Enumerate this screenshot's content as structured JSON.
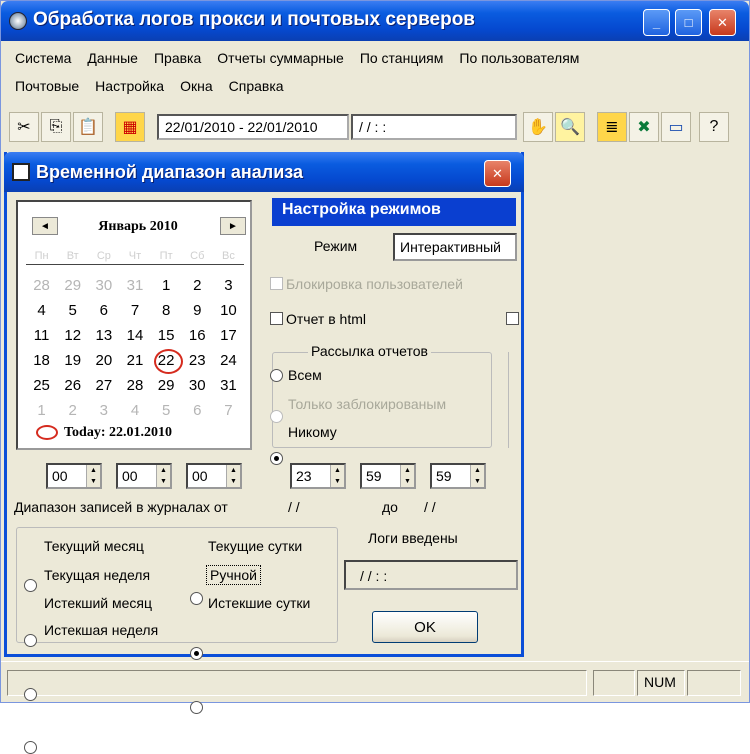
{
  "window": {
    "title": "Обработка логов прокси и почтовых серверов",
    "minimize": "_",
    "maximize": "□",
    "close": "✕"
  },
  "menu_row_1": [
    "Система",
    "Данные",
    "Правка",
    "Отчеты суммарные",
    "По станциям",
    "По пользователям"
  ],
  "menu_row_2": [
    "Почтовые",
    "Настройка",
    "Окна",
    "Справка"
  ],
  "toolbar": {
    "date_range": "22/01/2010 - 22/01/2010",
    "datetime_field": " / /     : :",
    "icons": [
      "scissors-icon",
      "copy-icon",
      "paste-icon",
      "grid-icon",
      "hand-icon",
      "preview-icon",
      "note-icon",
      "excel-icon",
      "monitor-icon",
      "help-icon"
    ]
  },
  "dialog": {
    "title": "Временной диапазон анализа",
    "close": "✕",
    "calendar": {
      "month": "Январь 2010",
      "prev": "◄",
      "next": "►",
      "weekdays": [
        "Пн",
        "Вт",
        "Ср",
        "Чт",
        "Пт",
        "Сб",
        "Вс"
      ],
      "today_label": "Today: 22.01.2010"
    },
    "settings_header": "Настройка режимов",
    "mode_label": "Режим",
    "mode_value": "Интерактивный",
    "block_users": "Блокировка пользователей",
    "report_html": "Отчет в html",
    "mailing_title": "Рассылка отчетов",
    "mailing_all": "Всем",
    "mailing_blocked": "Только заблокированым",
    "mailing_none": "Никому",
    "time_from": [
      "00",
      "00",
      "00"
    ],
    "time_to": [
      "23",
      "59",
      "59"
    ],
    "range_label": "Диапазон записей в журналах от",
    "range_from": "/ /",
    "range_to_label": "до",
    "range_to": "/ /",
    "logs_label": "Логи введены",
    "logs_value": "/ /     : :",
    "period": {
      "current_month": "Текущий месяц",
      "current_day": "Текущие сутки",
      "current_week": "Текущая неделя",
      "manual": "Ручной",
      "past_month": "Истекший месяц",
      "past_day": "Истекшие сутки",
      "past_week": "Истекшая неделя"
    },
    "ok": "OK"
  },
  "status_bar": {
    "num": "NUM"
  }
}
